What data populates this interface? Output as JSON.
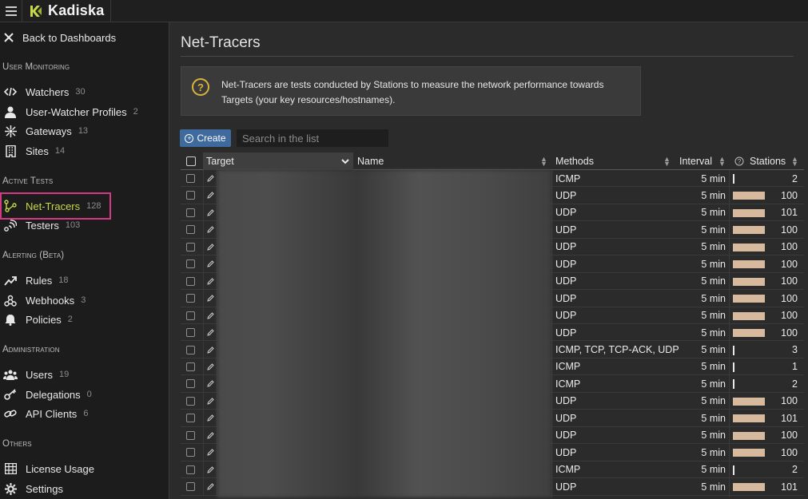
{
  "app": {
    "name": "Kadiska"
  },
  "sidebar": {
    "back_label": "Back to Dashboards",
    "sections": {
      "user_monitoring": "User Monitoring",
      "active_tests": "Active Tests",
      "alerting": "Alerting (Beta)",
      "administration": "Administration",
      "others": "Others"
    },
    "items": {
      "watchers": {
        "label": "Watchers",
        "count": "30",
        "icon": "code-icon"
      },
      "profiles": {
        "label": "User-Watcher Profiles",
        "count": "2",
        "icon": "user-icon"
      },
      "gateways": {
        "label": "Gateways",
        "count": "13",
        "icon": "network-hub-icon"
      },
      "sites": {
        "label": "Sites",
        "count": "14",
        "icon": "building-icon"
      },
      "net_tracers": {
        "label": "Net-Tracers",
        "count": "128",
        "icon": "route-icon"
      },
      "testers": {
        "label": "Testers",
        "count": "103",
        "icon": "signal-icon"
      },
      "rules": {
        "label": "Rules",
        "count": "18",
        "icon": "trend-icon"
      },
      "webhooks": {
        "label": "Webhooks",
        "count": "3",
        "icon": "webhook-icon"
      },
      "policies": {
        "label": "Policies",
        "count": "2",
        "icon": "bell-icon"
      },
      "users": {
        "label": "Users",
        "count": "19",
        "icon": "users-icon"
      },
      "delegations": {
        "label": "Delegations",
        "count": "0",
        "icon": "key-icon"
      },
      "api_clients": {
        "label": "API Clients",
        "count": "6",
        "icon": "link-icon"
      },
      "license": {
        "label": "License Usage",
        "count": "",
        "icon": "grid-icon"
      },
      "settings": {
        "label": "Settings",
        "count": "",
        "icon": "gear-icon"
      }
    }
  },
  "main": {
    "title": "Net-Tracers",
    "info": "Net-Tracers are tests conducted by Stations to measure the network performance towards Targets (your key resources/hostnames).",
    "create_label": "Create",
    "search_placeholder": "Search in the list",
    "columns": {
      "target": "Target",
      "name": "Name",
      "methods": "Methods",
      "interval": "Interval",
      "stations": "Stations"
    },
    "rows": [
      {
        "methods": "ICMP",
        "interval": "5 min",
        "stations": "2"
      },
      {
        "methods": "UDP",
        "interval": "5 min",
        "stations": "100"
      },
      {
        "methods": "UDP",
        "interval": "5 min",
        "stations": "101"
      },
      {
        "methods": "UDP",
        "interval": "5 min",
        "stations": "100"
      },
      {
        "methods": "UDP",
        "interval": "5 min",
        "stations": "100"
      },
      {
        "methods": "UDP",
        "interval": "5 min",
        "stations": "100"
      },
      {
        "methods": "UDP",
        "interval": "5 min",
        "stations": "100"
      },
      {
        "methods": "UDP",
        "interval": "5 min",
        "stations": "100"
      },
      {
        "methods": "UDP",
        "interval": "5 min",
        "stations": "100"
      },
      {
        "methods": "UDP",
        "interval": "5 min",
        "stations": "100"
      },
      {
        "methods": "ICMP, TCP, TCP-ACK, UDP",
        "interval": "5 min",
        "stations": "3"
      },
      {
        "methods": "ICMP",
        "interval": "5 min",
        "stations": "1"
      },
      {
        "methods": "ICMP",
        "interval": "5 min",
        "stations": "2"
      },
      {
        "methods": "UDP",
        "interval": "5 min",
        "stations": "100"
      },
      {
        "methods": "UDP",
        "interval": "5 min",
        "stations": "101"
      },
      {
        "methods": "UDP",
        "interval": "5 min",
        "stations": "100"
      },
      {
        "methods": "UDP",
        "interval": "5 min",
        "stations": "100"
      },
      {
        "methods": "ICMP",
        "interval": "5 min",
        "stations": "2"
      },
      {
        "methods": "UDP",
        "interval": "5 min",
        "stations": "101"
      }
    ]
  },
  "colors": {
    "accent": "#c7d84a",
    "highlight": "#d23a84",
    "button": "#3e6a9e",
    "station_bar": "#d7b99e",
    "info_icon": "#d9b43a"
  }
}
